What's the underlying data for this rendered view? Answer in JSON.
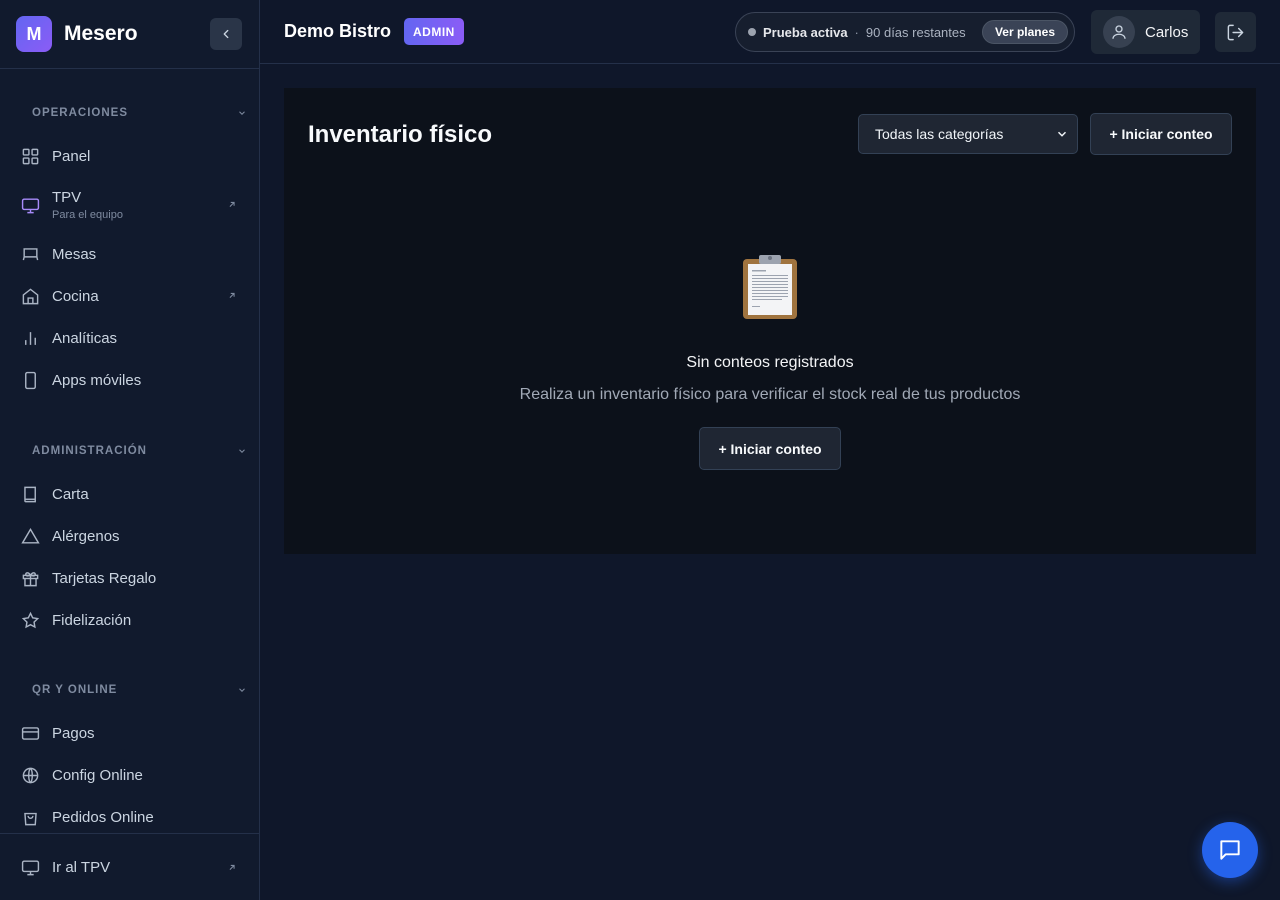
{
  "app": {
    "logo_letter": "M",
    "name": "Mesero"
  },
  "sidebar": {
    "sections": [
      {
        "title": "OPERACIONES",
        "items": [
          {
            "label": "Panel",
            "icon": "grid-icon"
          },
          {
            "label": "TPV",
            "sublabel": "Para el equipo",
            "icon": "monitor-icon",
            "external": true,
            "active": true
          },
          {
            "label": "Mesas",
            "icon": "table-icon"
          },
          {
            "label": "Cocina",
            "icon": "home-icon",
            "external": true
          },
          {
            "label": "Analíticas",
            "icon": "bar-chart-icon"
          },
          {
            "label": "Apps móviles",
            "icon": "smartphone-icon"
          }
        ]
      },
      {
        "title": "ADMINISTRACIÓN",
        "items": [
          {
            "label": "Carta",
            "icon": "book-icon"
          },
          {
            "label": "Alérgenos",
            "icon": "warning-icon"
          },
          {
            "label": "Tarjetas Regalo",
            "icon": "gift-icon"
          },
          {
            "label": "Fidelización",
            "icon": "star-icon"
          }
        ]
      },
      {
        "title": "QR Y ONLINE",
        "items": [
          {
            "label": "Pagos",
            "icon": "credit-card-icon"
          },
          {
            "label": "Config Online",
            "icon": "globe-icon"
          },
          {
            "label": "Pedidos Online",
            "icon": "shopping-bag-icon"
          }
        ]
      }
    ],
    "footer_label": "Ir al TPV"
  },
  "header": {
    "org_name": "Demo Bistro",
    "role_badge": "ADMIN",
    "trial_status": "Prueba activa",
    "trial_separator": "·",
    "trial_days": "90 días restantes",
    "plans_button": "Ver planes",
    "user_name": "Carlos"
  },
  "main": {
    "title": "Inventario físico",
    "category_select": {
      "value": "Todas las categorías"
    },
    "start_button": "+ Iniciar conteo",
    "empty": {
      "title": "Sin conteos registrados",
      "description": "Realiza un inventario físico para verificar el stock real de tus productos",
      "button": "+ Iniciar conteo"
    }
  },
  "colors": {
    "accent": "#6366f1",
    "fab": "#2563eb",
    "active_icon": "#a78bfa"
  }
}
